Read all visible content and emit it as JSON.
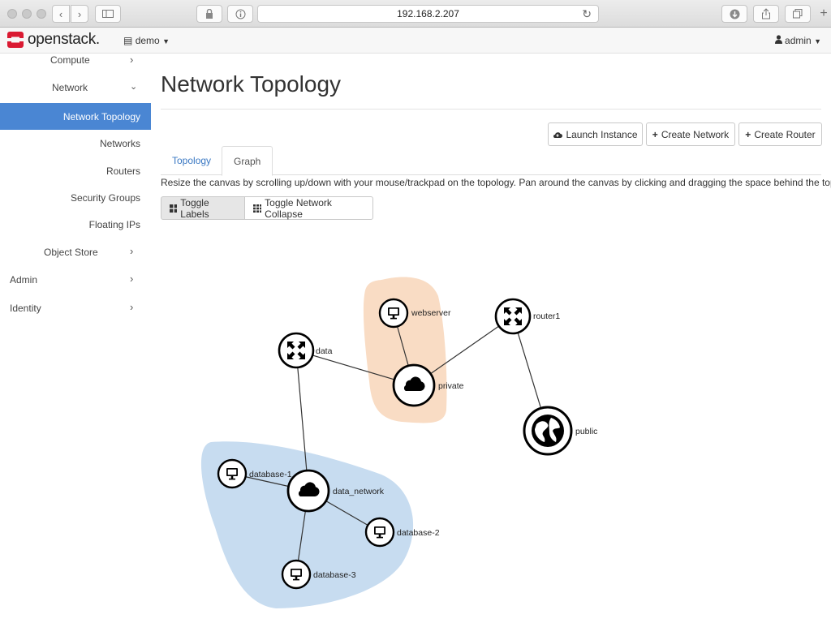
{
  "browser": {
    "url": "192.168.2.207",
    "icons": {
      "back": "chevron-left-icon",
      "forward": "chevron-right-icon",
      "sidebar": "sidebar-icon",
      "lock": "lock-icon",
      "info": "info-icon",
      "reload": "reload-icon",
      "download": "download-icon",
      "share": "share-icon",
      "tabs": "tabs-icon",
      "newtab": "plus-icon"
    }
  },
  "topnav": {
    "brand": "openstack.",
    "project": "demo",
    "user": "admin",
    "brand_color": "#da1a32"
  },
  "sidebar": {
    "items": [
      {
        "label": "Compute",
        "chevron": "chevron-right-icon"
      },
      {
        "label": "Network",
        "chevron": "chevron-down-icon"
      },
      {
        "label": "Network Topology",
        "active": true
      },
      {
        "label": "Networks"
      },
      {
        "label": "Routers"
      },
      {
        "label": "Security Groups"
      },
      {
        "label": "Floating IPs"
      },
      {
        "label": "Object Store",
        "chevron": "chevron-right-icon"
      },
      {
        "label": "Admin",
        "chevron": "chevron-right-icon"
      },
      {
        "label": "Identity",
        "chevron": "chevron-right-icon"
      }
    ],
    "active_color": "#4a86d3"
  },
  "main": {
    "title": "Network Topology",
    "actions": {
      "launch": "Launch Instance",
      "create_network": "Create Network",
      "create_router": "Create Router"
    },
    "tabs": [
      {
        "label": "Topology",
        "active": false
      },
      {
        "label": "Graph",
        "active": true
      }
    ],
    "hint": "Resize the canvas by scrolling up/down with your mouse/trackpad on the topology. Pan around the canvas by clicking and dragging the space behind the topology.",
    "toggles": {
      "labels": "Toggle Labels",
      "collapse": "Toggle Network Collapse"
    }
  },
  "graph": {
    "nodes": {
      "webserver": {
        "label": "webserver",
        "kind": "instance"
      },
      "router1": {
        "label": "router1",
        "kind": "router"
      },
      "data": {
        "label": "data",
        "kind": "router"
      },
      "private": {
        "label": "private",
        "kind": "network"
      },
      "public": {
        "label": "public",
        "kind": "external-network"
      },
      "database1": {
        "label": "database-1",
        "kind": "instance"
      },
      "data_network": {
        "label": "data_network",
        "kind": "network"
      },
      "database2": {
        "label": "database-2",
        "kind": "instance"
      },
      "database3": {
        "label": "database-3",
        "kind": "instance"
      }
    },
    "colors": {
      "private_group": "#f9dcc4",
      "data_group": "#c7dcf0"
    }
  }
}
